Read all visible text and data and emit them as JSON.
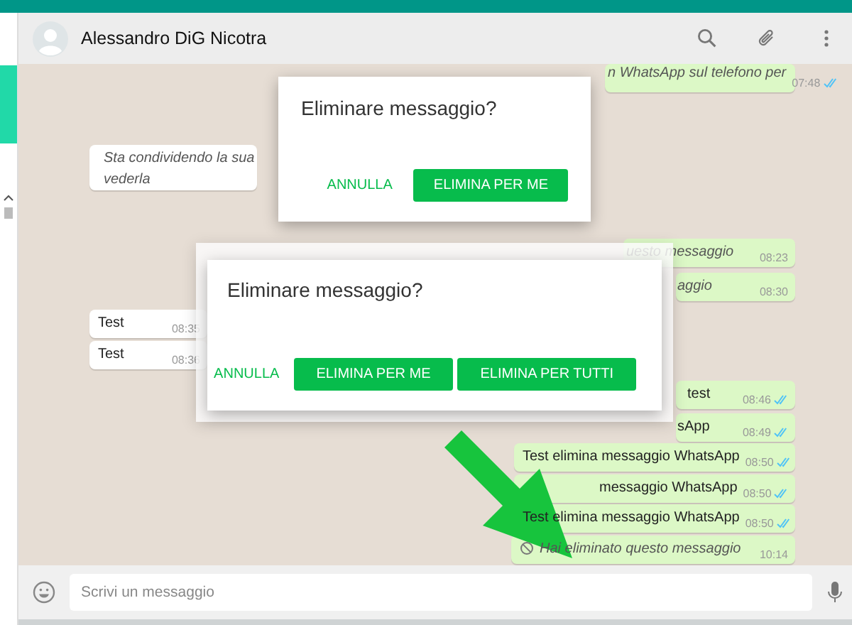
{
  "header": {
    "contact_name": "Alessandro DiG Nicotra"
  },
  "messages": [
    {
      "kind": "outgoing",
      "text": "n WhatsApp sul telefono per",
      "time": "07:48",
      "italic": true,
      "read": true
    },
    {
      "kind": "location",
      "text": "Sta condividendo la sua",
      "text_2": "vederla",
      "italic": true
    },
    {
      "kind": "outgoing",
      "text": "uesto messaggio",
      "time": "08:23",
      "italic": true,
      "read": false
    },
    {
      "kind": "outgoing",
      "text": "aggio",
      "time": "08:30",
      "italic": true,
      "read": false
    },
    {
      "kind": "incoming",
      "text": "Test",
      "time": "08:35",
      "italic": false
    },
    {
      "kind": "incoming",
      "text": "Test",
      "time": "08:36",
      "italic": false
    },
    {
      "kind": "outgoing",
      "text": "test",
      "time": "08:46",
      "italic": false,
      "read": true
    },
    {
      "kind": "outgoing",
      "text": "sApp",
      "time": "08:49",
      "italic": false,
      "read": true
    },
    {
      "kind": "outgoing",
      "text": "Test elimina messaggio WhatsApp",
      "time": "08:50",
      "italic": false,
      "read": true
    },
    {
      "kind": "outgoing",
      "text": "messaggio WhatsApp",
      "time": "08:50",
      "italic": false,
      "read": true
    },
    {
      "kind": "outgoing",
      "text": "Test elimina messaggio WhatsApp",
      "time": "08:50",
      "italic": false,
      "read": true
    },
    {
      "kind": "deleted",
      "text": "Hai eliminato questo messaggio",
      "time": "10:14",
      "italic": true,
      "read": false
    }
  ],
  "dialogs": [
    {
      "title": "Eliminare messaggio?",
      "buttons": [
        {
          "label": "ANNULLA",
          "kind": "text"
        },
        {
          "label": "ELIMINA PER ME",
          "kind": "filled"
        }
      ]
    },
    {
      "title": "Eliminare messaggio?",
      "buttons": [
        {
          "label": "ANNULLA",
          "kind": "text"
        },
        {
          "label": "ELIMINA PER ME",
          "kind": "filled"
        },
        {
          "label": "ELIMINA PER TUTTI",
          "kind": "filled"
        }
      ]
    }
  ],
  "composer": {
    "placeholder": "Scrivi un messaggio"
  }
}
